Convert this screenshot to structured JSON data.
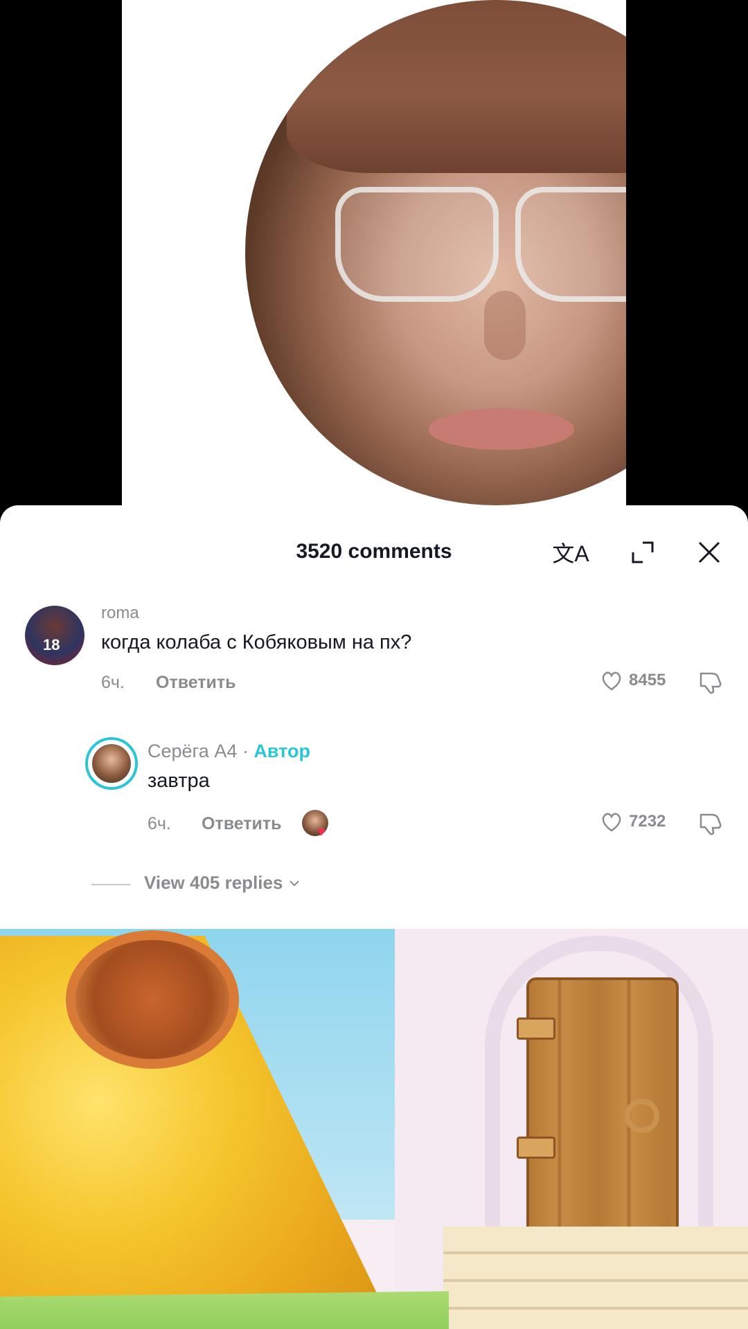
{
  "comments_panel": {
    "title": "3520 comments",
    "translate_icon": "translate-icon",
    "expand_icon": "expand-icon",
    "close_icon": "close-icon"
  },
  "comments": [
    {
      "username": "roma",
      "text": "когда колаба с Кобяковым на пх?",
      "time": "6ч.",
      "reply_label": "Ответить",
      "likes": "8455"
    },
    {
      "username": "Серёга А4 ·",
      "author_badge": "Автор",
      "text": "завтра",
      "time": "6ч.",
      "reply_label": "Ответить",
      "likes": "7232"
    }
  ],
  "view_replies": "View 405 replies",
  "colors": {
    "author_accent": "#2ac6d5",
    "text_primary": "#161823",
    "text_secondary": "#8a8b91",
    "like_heart_red": "#fe2c55"
  }
}
